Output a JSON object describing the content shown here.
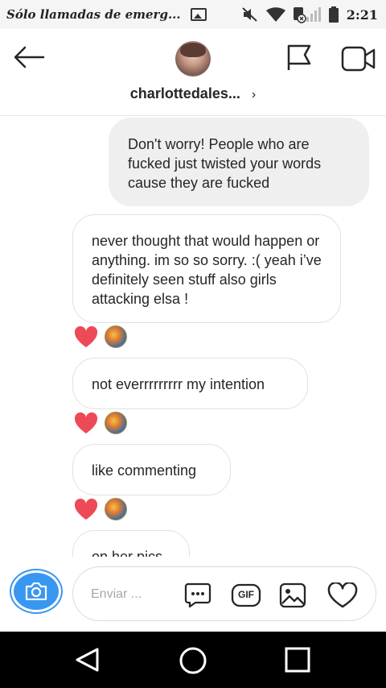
{
  "status_bar": {
    "carrier": "Sólo llamadas de emerg...",
    "time": "2:21",
    "icons": [
      "gallery-icon",
      "mute-icon",
      "wifi-icon",
      "sim-signal-icon",
      "battery-icon"
    ]
  },
  "header": {
    "username": "charlottedales...",
    "icons": [
      "back-arrow-icon",
      "avatar",
      "flag-icon",
      "video-call-icon"
    ]
  },
  "messages": [
    {
      "direction": "out",
      "text": "Don't worry! People who are fucked just twisted your words cause they are fucked"
    },
    {
      "direction": "in",
      "text": "never thought that would happen or anything. im so so sorry. :( yeah i’ve definitely seen stuff also girls attacking elsa !"
    },
    {
      "direction": "in",
      "text": "not everrrrrrrrr my intention"
    },
    {
      "direction": "in",
      "text": "like commenting"
    },
    {
      "direction": "in",
      "text": "on her pics"
    }
  ],
  "composer": {
    "placeholder": "Enviar ...",
    "gif_label": "GIF",
    "icons": [
      "camera-icon",
      "chat-bubble-icon",
      "gif-icon",
      "image-icon",
      "heart-icon"
    ]
  },
  "colors": {
    "accent": "#3897f0",
    "reaction_heart": "#ed4956",
    "outgoing_bubble": "#efefef"
  }
}
